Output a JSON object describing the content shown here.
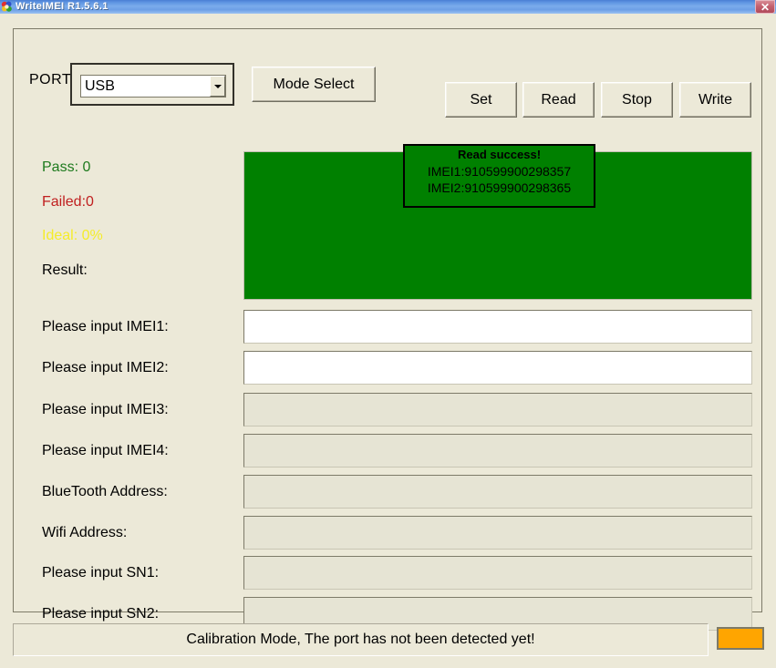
{
  "window": {
    "title": "WriteIMEI R1.5.6.1",
    "icon": "app-logo-icon",
    "close_label": "✕"
  },
  "toolbar": {
    "port_label": "PORT",
    "port_value": "USB",
    "port_options": [
      "USB"
    ],
    "mode_select_label": "Mode Select",
    "set_label": "Set",
    "read_label": "Read",
    "stop_label": "Stop",
    "write_label": "Write"
  },
  "status": {
    "pass_label": "Pass:  0",
    "failed_label": "Failed:0",
    "ideal_label": "Ideal: 0%",
    "result_label": "Result:",
    "pass_color": "#1e7a1e",
    "failed_color": "#c02020",
    "ideal_color": "#f5ec2a",
    "result_color": "#000000"
  },
  "log": {
    "background_color": "#008000",
    "text": ""
  },
  "popup": {
    "title": "Read success!",
    "line1": "IMEI1:910599900298357",
    "line2": "IMEI2:910599900298365"
  },
  "fields": [
    {
      "label": "Please input IMEI1:",
      "value": "",
      "placeholder": "",
      "enabled": true,
      "name": "imei1"
    },
    {
      "label": "Please input IMEI2:",
      "value": "",
      "placeholder": "",
      "enabled": true,
      "name": "imei2"
    },
    {
      "label": "Please input IMEI3:",
      "value": "",
      "placeholder": "",
      "enabled": false,
      "name": "imei3"
    },
    {
      "label": "Please input IMEI4:",
      "value": "",
      "placeholder": "",
      "enabled": false,
      "name": "imei4"
    },
    {
      "label": "BlueTooth Address:",
      "value": "",
      "placeholder": "",
      "enabled": false,
      "name": "bluetooth-address"
    },
    {
      "label": "Wifi Address:",
      "value": "",
      "placeholder": "",
      "enabled": false,
      "name": "wifi-address"
    },
    {
      "label": "Please input SN1:",
      "value": "",
      "placeholder": "",
      "enabled": false,
      "name": "sn1"
    },
    {
      "label": "Please input SN2:",
      "value": "",
      "placeholder": "",
      "enabled": false,
      "name": "sn2"
    }
  ],
  "statusbar": {
    "message": "Calibration Mode, The port has not been detected yet!",
    "indicator_color": "#ffa500"
  }
}
